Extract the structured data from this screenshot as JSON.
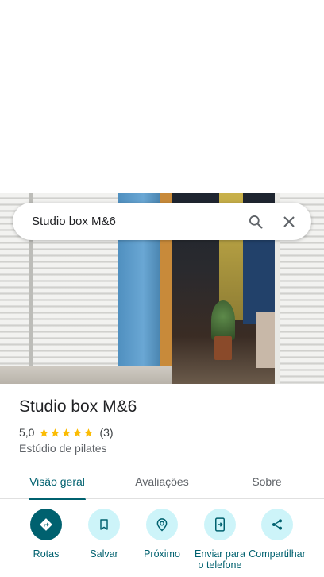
{
  "search": {
    "query": "Studio box M&6"
  },
  "place": {
    "name": "Studio box M&6",
    "rating": "5,0",
    "stars": 5,
    "review_count": "(3)",
    "category": "Estúdio de pilates"
  },
  "tabs": [
    {
      "label": "Visão geral",
      "active": true
    },
    {
      "label": "Avaliações",
      "active": false
    },
    {
      "label": "Sobre",
      "active": false
    }
  ],
  "actions": [
    {
      "label": "Rotas",
      "icon": "directions-icon"
    },
    {
      "label": "Salvar",
      "icon": "bookmark-icon"
    },
    {
      "label": "Próximo",
      "icon": "nearby-icon"
    },
    {
      "label": "Enviar para o telefone",
      "icon": "send-to-phone-icon"
    },
    {
      "label": "Compartilhar",
      "icon": "share-icon"
    }
  ],
  "colors": {
    "accent": "#00616f",
    "action_bg": "#cdf4f9",
    "star": "#fbbc04"
  }
}
